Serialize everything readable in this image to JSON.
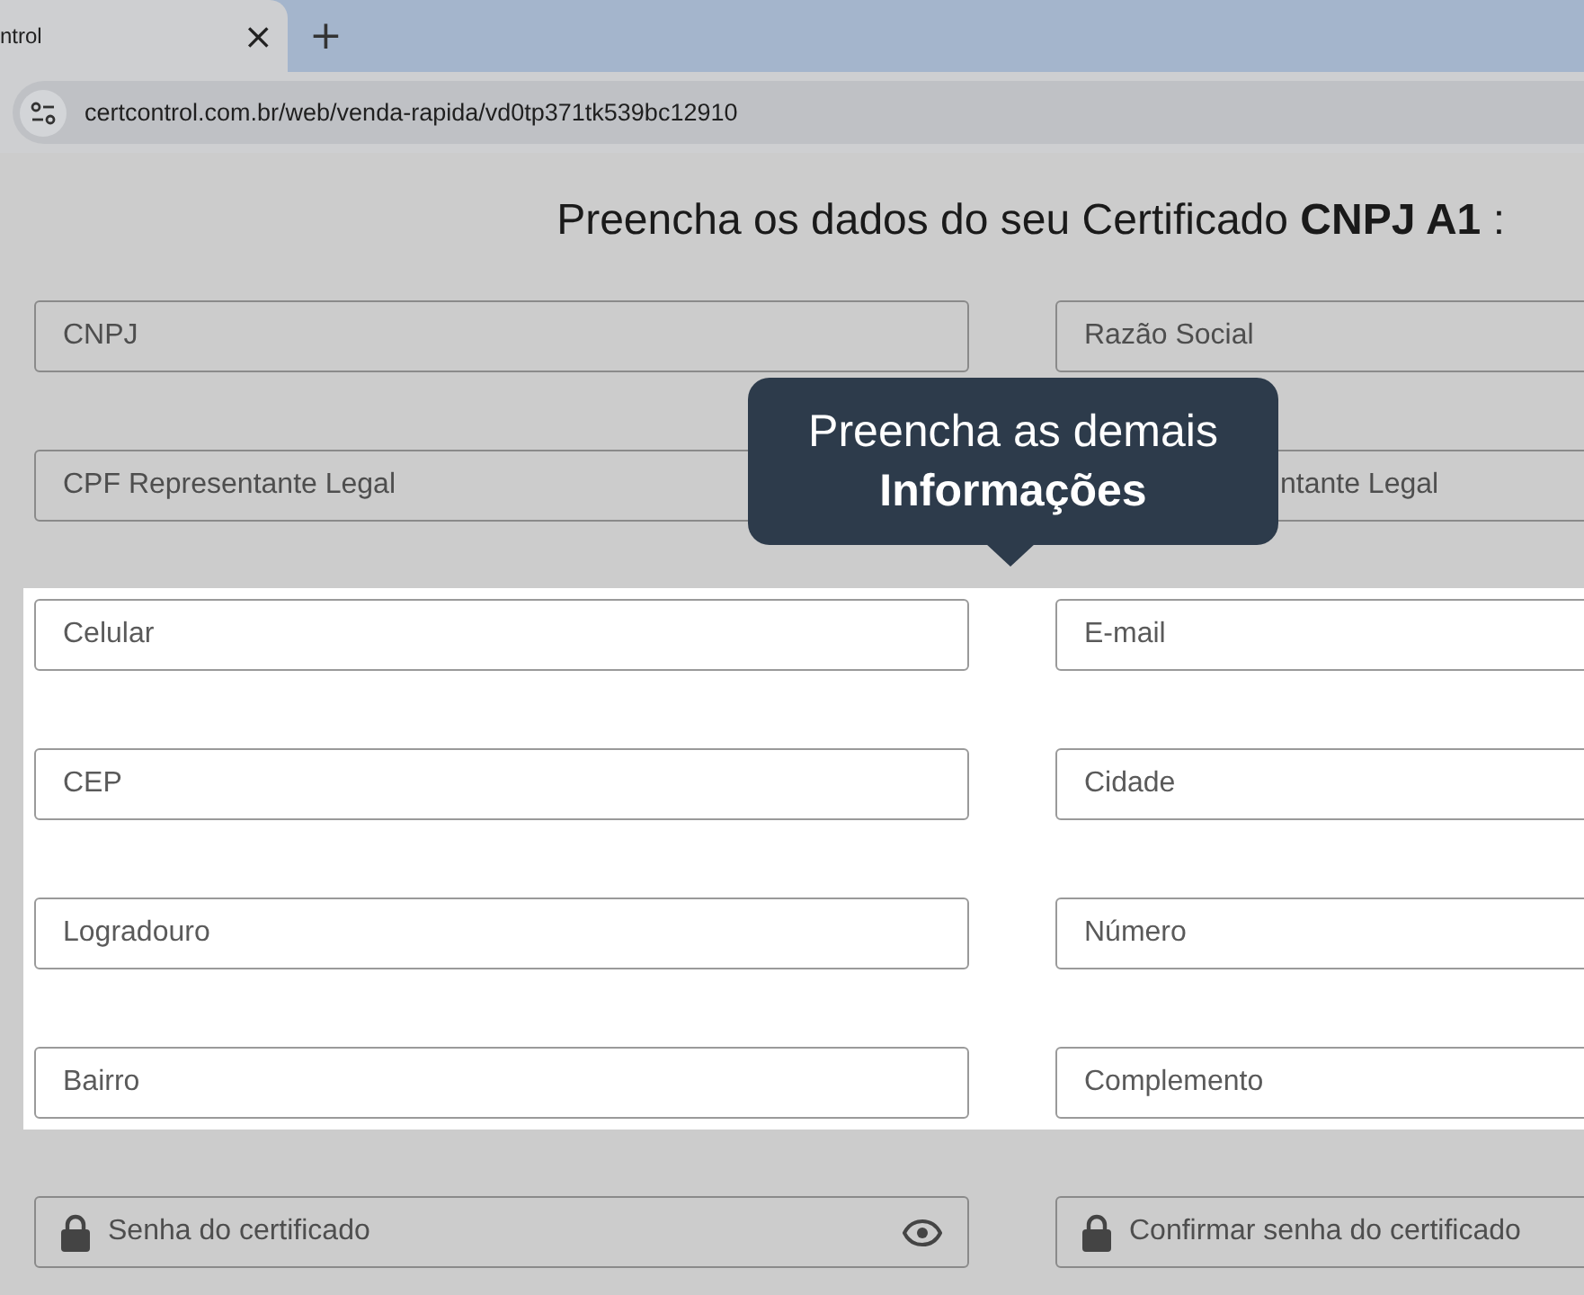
{
  "browser": {
    "tab": {
      "title": "ntrol",
      "close": "×"
    },
    "new_tab": "+",
    "url": "certcontrol.com.br/web/venda-rapida/vd0tp371tk539bc12910"
  },
  "page": {
    "title": "Preencha os dados do seu Certificado **CNPJ A1** :",
    "dimmed_fields": [
      {
        "placeholder": "CNPJ"
      },
      {
        "placeholder": "Razão Social"
      },
      {
        "placeholder": "CPF Representante Legal"
      },
      {
        "placeholder": "ntante Legal",
        "partly_covered": true
      }
    ],
    "highlighted_fields": [
      {
        "placeholder": "Celular"
      },
      {
        "placeholder": "E-mail"
      },
      {
        "placeholder": "CEP"
      },
      {
        "placeholder": "Cidade"
      },
      {
        "placeholder": "Logradouro"
      },
      {
        "placeholder": "Número"
      },
      {
        "placeholder": "Bairro"
      },
      {
        "placeholder": "Complemento"
      }
    ],
    "password_fields": [
      {
        "placeholder": "Senha do certificado",
        "reveal_toggle": true
      },
      {
        "placeholder": "Confirmar senha do certificado"
      }
    ]
  },
  "tooltip": {
    "text": "Preencha as demais **Informações**"
  }
}
